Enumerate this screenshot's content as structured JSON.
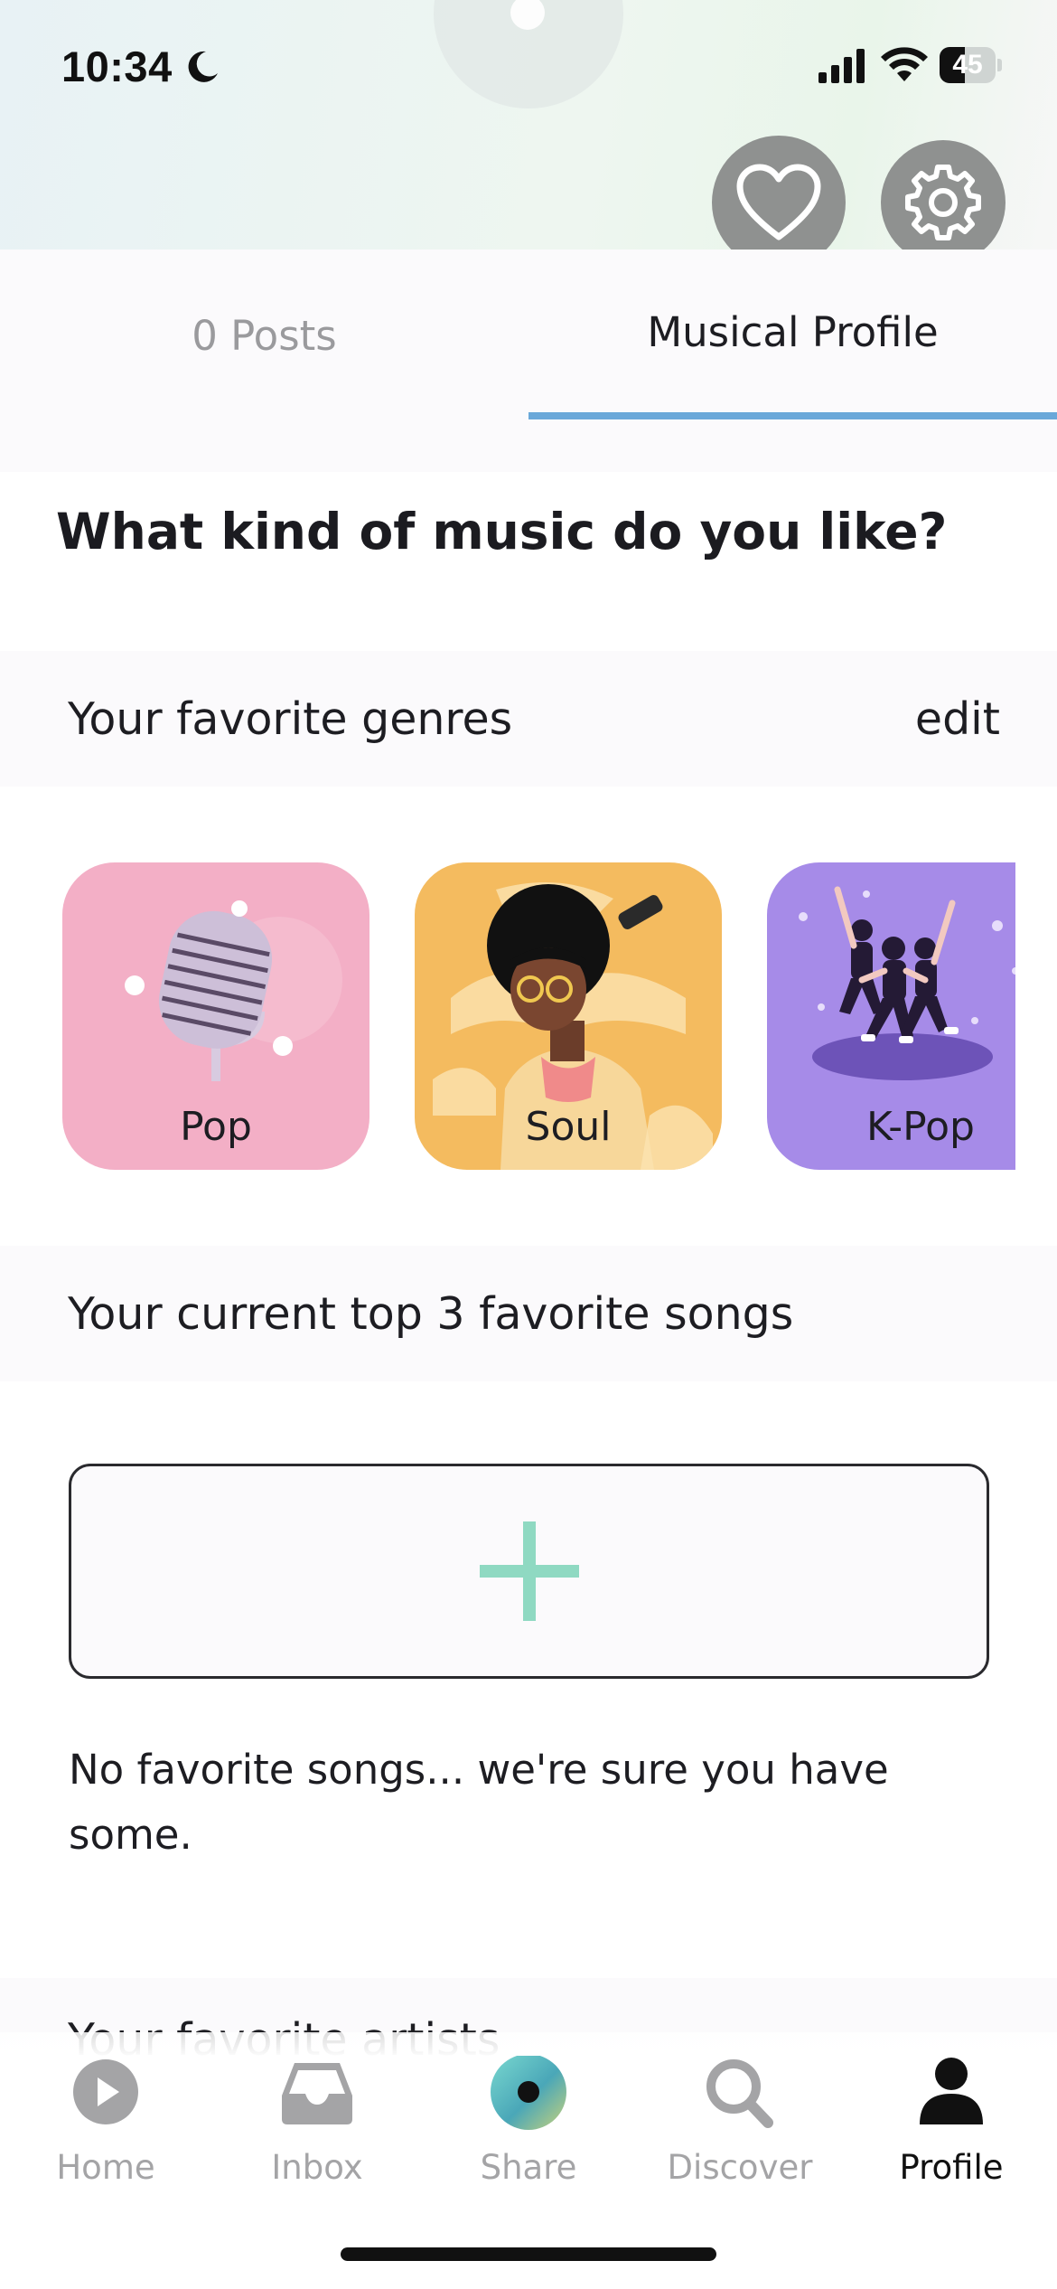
{
  "status_bar": {
    "time": "10:34",
    "battery_level": "45",
    "battery_fraction": 0.45,
    "icons": [
      "moon-icon",
      "cellular-signal-icon",
      "wifi-icon",
      "battery-icon"
    ]
  },
  "header": {
    "icons": [
      "heart-icon",
      "gear-icon"
    ]
  },
  "tabs": [
    {
      "label": "0 Posts",
      "active": false
    },
    {
      "label": "Musical Profile",
      "active": true
    }
  ],
  "question": "What kind of music do you like?",
  "genres_section": {
    "title": "Your favorite genres",
    "edit_label": "edit",
    "genres": [
      {
        "label": "Pop",
        "color": "#f3afc6"
      },
      {
        "label": "Soul",
        "color": "#f4bb5f"
      },
      {
        "label": "K-Pop",
        "color": "#a68be8"
      }
    ]
  },
  "songs_section": {
    "title": "Your current top 3 favorite songs",
    "add_icon": "plus-icon",
    "empty_message": "No favorite songs... we're sure you have some."
  },
  "artists_section": {
    "title": "Your favorite artists"
  },
  "bottom_nav": [
    {
      "label": "Home",
      "icon": "play-circle-icon",
      "active": false
    },
    {
      "label": "Inbox",
      "icon": "inbox-tray-icon",
      "active": false
    },
    {
      "label": "Share",
      "icon": "share-orb-icon",
      "active": false
    },
    {
      "label": "Discover",
      "icon": "search-icon",
      "active": false
    },
    {
      "label": "Profile",
      "icon": "person-icon",
      "active": true
    }
  ],
  "colors": {
    "accent_underline": "#6aa8d9",
    "plus_color": "#8fd9c2",
    "icon_button_bg": "#8f9190"
  }
}
